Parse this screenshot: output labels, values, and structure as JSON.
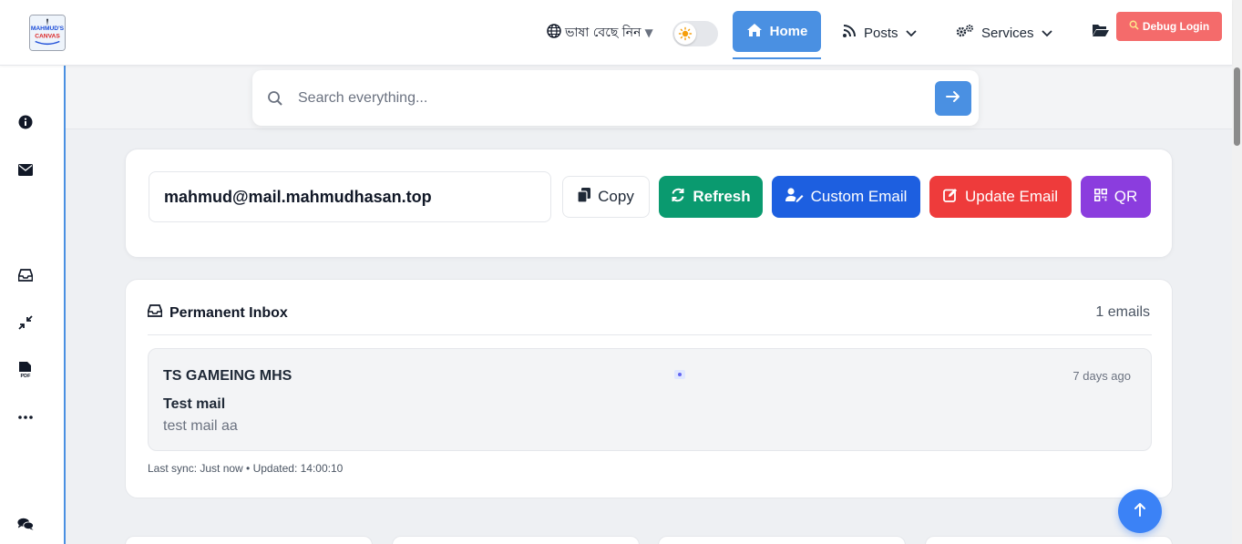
{
  "header": {
    "logo": {
      "line1": "MAHMUD'S",
      "line2": "CANVAS"
    },
    "language_label": "ভাষা বেছে নিন",
    "nav": {
      "home": "Home",
      "posts": "Posts",
      "services": "Services"
    },
    "debug_login": "Debug Login",
    "accent_color": "#4a90e2"
  },
  "search": {
    "placeholder": "Search everything..."
  },
  "email_card": {
    "address": "mahmud@mail.mahmudhasan.top",
    "buttons": {
      "copy": "Copy",
      "refresh": "Refresh",
      "custom_email": "Custom Email",
      "update_email": "Update Email",
      "qr": "QR"
    },
    "colors": {
      "refresh": "#0a9a6f",
      "custom_email": "#1d5fe0",
      "update_email": "#ee3b3b",
      "qr": "#8b3dde"
    }
  },
  "inbox": {
    "title": "Permanent Inbox",
    "count": "1 emails",
    "messages": [
      {
        "from": "TS GAMEING MHS",
        "time": "7 days ago",
        "subject": "Test mail",
        "preview": "test mail aa"
      }
    ],
    "sync_status": "Last sync: Just now • Updated: 14:00:10"
  },
  "sidebar": {
    "icons": [
      "info-icon",
      "envelope-icon",
      "inbox-icon",
      "compress-icon",
      "pdf-file-icon",
      "more-icon",
      "chat-icon"
    ]
  }
}
